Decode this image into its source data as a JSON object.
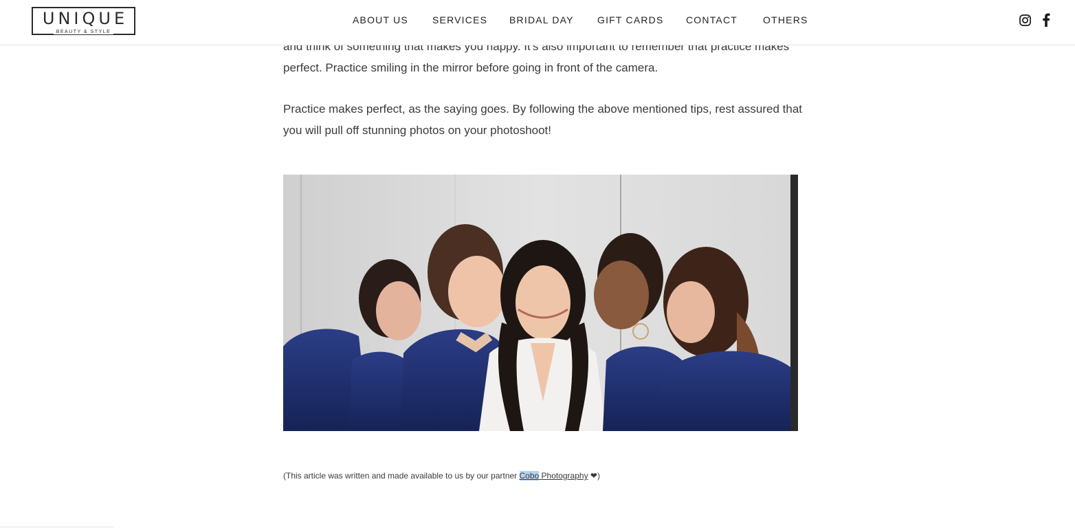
{
  "brand": {
    "name": "UNIQUE",
    "tagline": "BEAUTY & STYLE"
  },
  "nav": {
    "items": [
      {
        "label": "ABOUT US"
      },
      {
        "label": "SERVICES"
      },
      {
        "label": "BRIDAL DAY"
      },
      {
        "label": "GIFT CARDS"
      },
      {
        "label": "CONTACT"
      },
      {
        "label": "OTHERS"
      }
    ]
  },
  "social": {
    "instagram_icon": "instagram-icon",
    "facebook_icon": "facebook-icon"
  },
  "article": {
    "paragraph_1": "and think of something that makes you happy. It's also important to remember that practice makes perfect. Practice smiling in the mirror before going in front of the camera.",
    "paragraph_2": "Practice makes perfect, as the saying goes. By following the above mentioned tips, rest assured that you will pull off stunning photos on your photoshoot!",
    "credit_prefix": "(This article was written and made available to us by our partner ",
    "credit_link_selected": "Cobo",
    "credit_link_rest": " Photography",
    "credit_heart": "❤",
    "credit_suffix": ")"
  },
  "colors": {
    "robe_blue": "#1f2f6e",
    "text": "#3a3a3a",
    "selection": "#b7d3f5"
  }
}
